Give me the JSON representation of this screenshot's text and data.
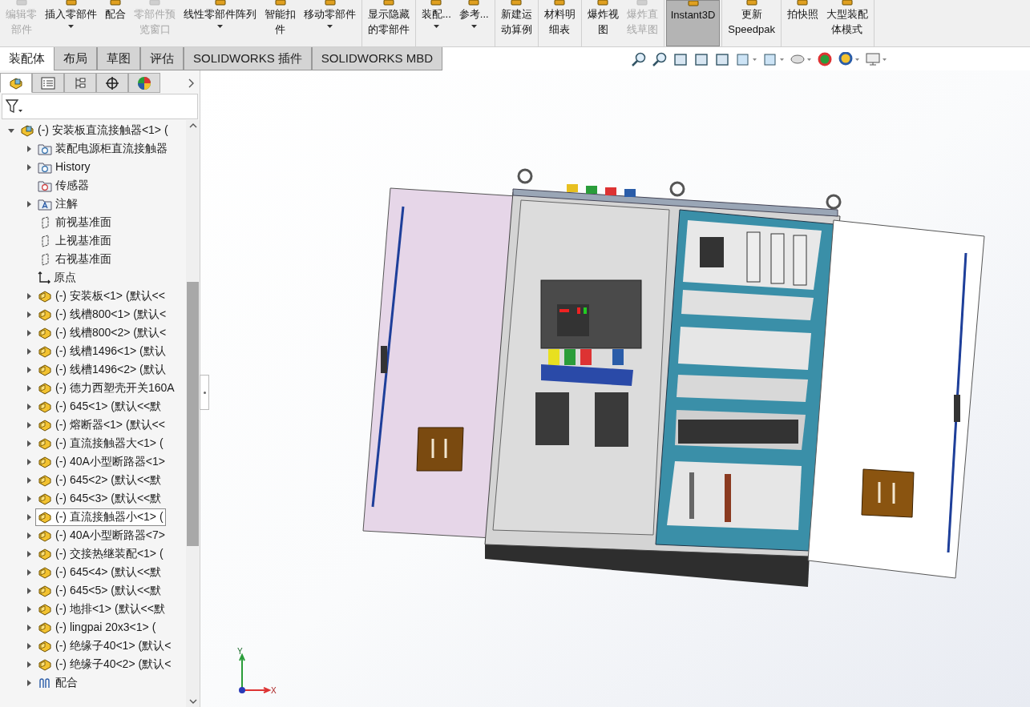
{
  "toolbar": {
    "groups": [
      [
        {
          "label": [
            "编辑零",
            "部件"
          ],
          "disabled": true,
          "dropdown": false,
          "selected": false
        },
        {
          "label": [
            "插入零部件"
          ],
          "disabled": false,
          "dropdown": true,
          "selected": false
        },
        {
          "label": [
            "配合"
          ],
          "disabled": false,
          "dropdown": false,
          "selected": false
        },
        {
          "label": [
            "零部件预",
            "览窗口"
          ],
          "disabled": true,
          "dropdown": false,
          "selected": false
        },
        {
          "label": [
            "线性零部件阵列"
          ],
          "disabled": false,
          "dropdown": true,
          "selected": false
        },
        {
          "label": [
            "智能扣",
            "件"
          ],
          "disabled": false,
          "dropdown": false,
          "selected": false
        },
        {
          "label": [
            "移动零部件"
          ],
          "disabled": false,
          "dropdown": true,
          "selected": false
        }
      ],
      [
        {
          "label": [
            "显示隐藏",
            "的零部件"
          ],
          "disabled": false,
          "dropdown": false,
          "selected": false
        }
      ],
      [
        {
          "label": [
            "装配..."
          ],
          "disabled": false,
          "dropdown": true,
          "selected": false
        },
        {
          "label": [
            "参考..."
          ],
          "disabled": false,
          "dropdown": true,
          "selected": false
        }
      ],
      [
        {
          "label": [
            "新建运",
            "动算例"
          ],
          "disabled": false,
          "dropdown": false,
          "selected": false
        }
      ],
      [
        {
          "label": [
            "材料明",
            "细表"
          ],
          "disabled": false,
          "dropdown": false,
          "selected": false
        }
      ],
      [
        {
          "label": [
            "爆炸视",
            "图"
          ],
          "disabled": false,
          "dropdown": false,
          "selected": false
        },
        {
          "label": [
            "爆炸直",
            "线草图"
          ],
          "disabled": true,
          "dropdown": false,
          "selected": false
        }
      ],
      [
        {
          "label": [
            "Instant3D"
          ],
          "disabled": false,
          "dropdown": false,
          "selected": true
        }
      ],
      [
        {
          "label": [
            "更新",
            "Speedpak"
          ],
          "disabled": false,
          "dropdown": false,
          "selected": false
        }
      ],
      [
        {
          "label": [
            "拍快照"
          ],
          "disabled": false,
          "dropdown": false,
          "selected": false
        },
        {
          "label": [
            "大型装配",
            "体模式"
          ],
          "disabled": false,
          "dropdown": false,
          "selected": false
        }
      ]
    ]
  },
  "command_tabs": [
    {
      "label": "装配体",
      "selected": true
    },
    {
      "label": "布局",
      "selected": false
    },
    {
      "label": "草图",
      "selected": false
    },
    {
      "label": "评估",
      "selected": false
    },
    {
      "label": "SOLIDWORKS 插件",
      "selected": false
    },
    {
      "label": "SOLIDWORKS MBD",
      "selected": false
    }
  ],
  "panel_tabs": [
    {
      "kind": "feature-tree",
      "selected": true
    },
    {
      "kind": "property",
      "selected": false
    },
    {
      "kind": "configuration",
      "selected": false
    },
    {
      "kind": "dimxpert",
      "selected": false
    },
    {
      "kind": "display",
      "selected": false
    }
  ],
  "tree": [
    {
      "kind": "assembly",
      "label": "(-) 安装板直流接触器<1> (",
      "expanded": true,
      "selected": false,
      "children": [
        {
          "kind": "folder-mate",
          "label": "装配电源柜直流接触器",
          "expanded": false,
          "selected": false
        },
        {
          "kind": "history",
          "label": "History",
          "expanded": false,
          "selected": false
        },
        {
          "kind": "sensor",
          "label": "传感器",
          "selected": false
        },
        {
          "kind": "annotation",
          "label": "注解",
          "expanded": false,
          "selected": false
        },
        {
          "kind": "plane",
          "label": "前视基准面",
          "selected": false
        },
        {
          "kind": "plane",
          "label": "上视基准面",
          "selected": false
        },
        {
          "kind": "plane",
          "label": "右视基准面",
          "selected": false
        },
        {
          "kind": "origin",
          "label": "原点",
          "selected": false
        },
        {
          "kind": "part",
          "label": "(-) 安装板<1> (默认<<",
          "expanded": false,
          "selected": false
        },
        {
          "kind": "part",
          "label": "(-) 线槽800<1> (默认<",
          "expanded": false,
          "selected": false
        },
        {
          "kind": "part",
          "label": "(-) 线槽800<2> (默认<",
          "expanded": false,
          "selected": false
        },
        {
          "kind": "part",
          "label": "(-) 线槽1496<1> (默认",
          "expanded": false,
          "selected": false
        },
        {
          "kind": "part",
          "label": "(-) 线槽1496<2> (默认",
          "expanded": false,
          "selected": false
        },
        {
          "kind": "part",
          "label": "(-) 德力西塑壳开关160A",
          "expanded": false,
          "selected": false
        },
        {
          "kind": "part",
          "label": "(-) 645<1> (默认<<默",
          "expanded": false,
          "selected": false
        },
        {
          "kind": "part",
          "label": "(-) 熔断器<1> (默认<<",
          "expanded": false,
          "selected": false
        },
        {
          "kind": "part",
          "label": "(-) 直流接触器大<1> (",
          "expanded": false,
          "selected": false
        },
        {
          "kind": "part",
          "label": "(-) 40A小型断路器<1>",
          "expanded": false,
          "selected": false
        },
        {
          "kind": "part",
          "label": "(-) 645<2> (默认<<默",
          "expanded": false,
          "selected": false
        },
        {
          "kind": "part",
          "label": "(-) 645<3> (默认<<默",
          "expanded": false,
          "selected": false
        },
        {
          "kind": "part",
          "label": "(-) 直流接触器小<1> (",
          "expanded": false,
          "selected": true
        },
        {
          "kind": "part",
          "label": "(-) 40A小型断路器<7>",
          "expanded": false,
          "selected": false
        },
        {
          "kind": "part",
          "label": "(-) 交接热继装配<1> (",
          "expanded": false,
          "selected": false
        },
        {
          "kind": "part",
          "label": "(-) 645<4> (默认<<默",
          "expanded": false,
          "selected": false
        },
        {
          "kind": "part",
          "label": "(-) 645<5> (默认<<默",
          "expanded": false,
          "selected": false
        },
        {
          "kind": "part",
          "label": "(-) 地排<1> (默认<<默",
          "expanded": false,
          "selected": false
        },
        {
          "kind": "part",
          "label": "(-) lingpai 20x3<1> (",
          "expanded": false,
          "selected": false
        },
        {
          "kind": "part",
          "label": "(-) 绝缘子40<1> (默认<",
          "expanded": false,
          "selected": false
        },
        {
          "kind": "part",
          "label": "(-) 绝缘子40<2> (默认<",
          "expanded": false,
          "selected": false
        },
        {
          "kind": "mates",
          "label": "配合",
          "expanded": false,
          "selected": false
        }
      ]
    }
  ],
  "triad": {
    "x": "X",
    "y": "Y"
  }
}
